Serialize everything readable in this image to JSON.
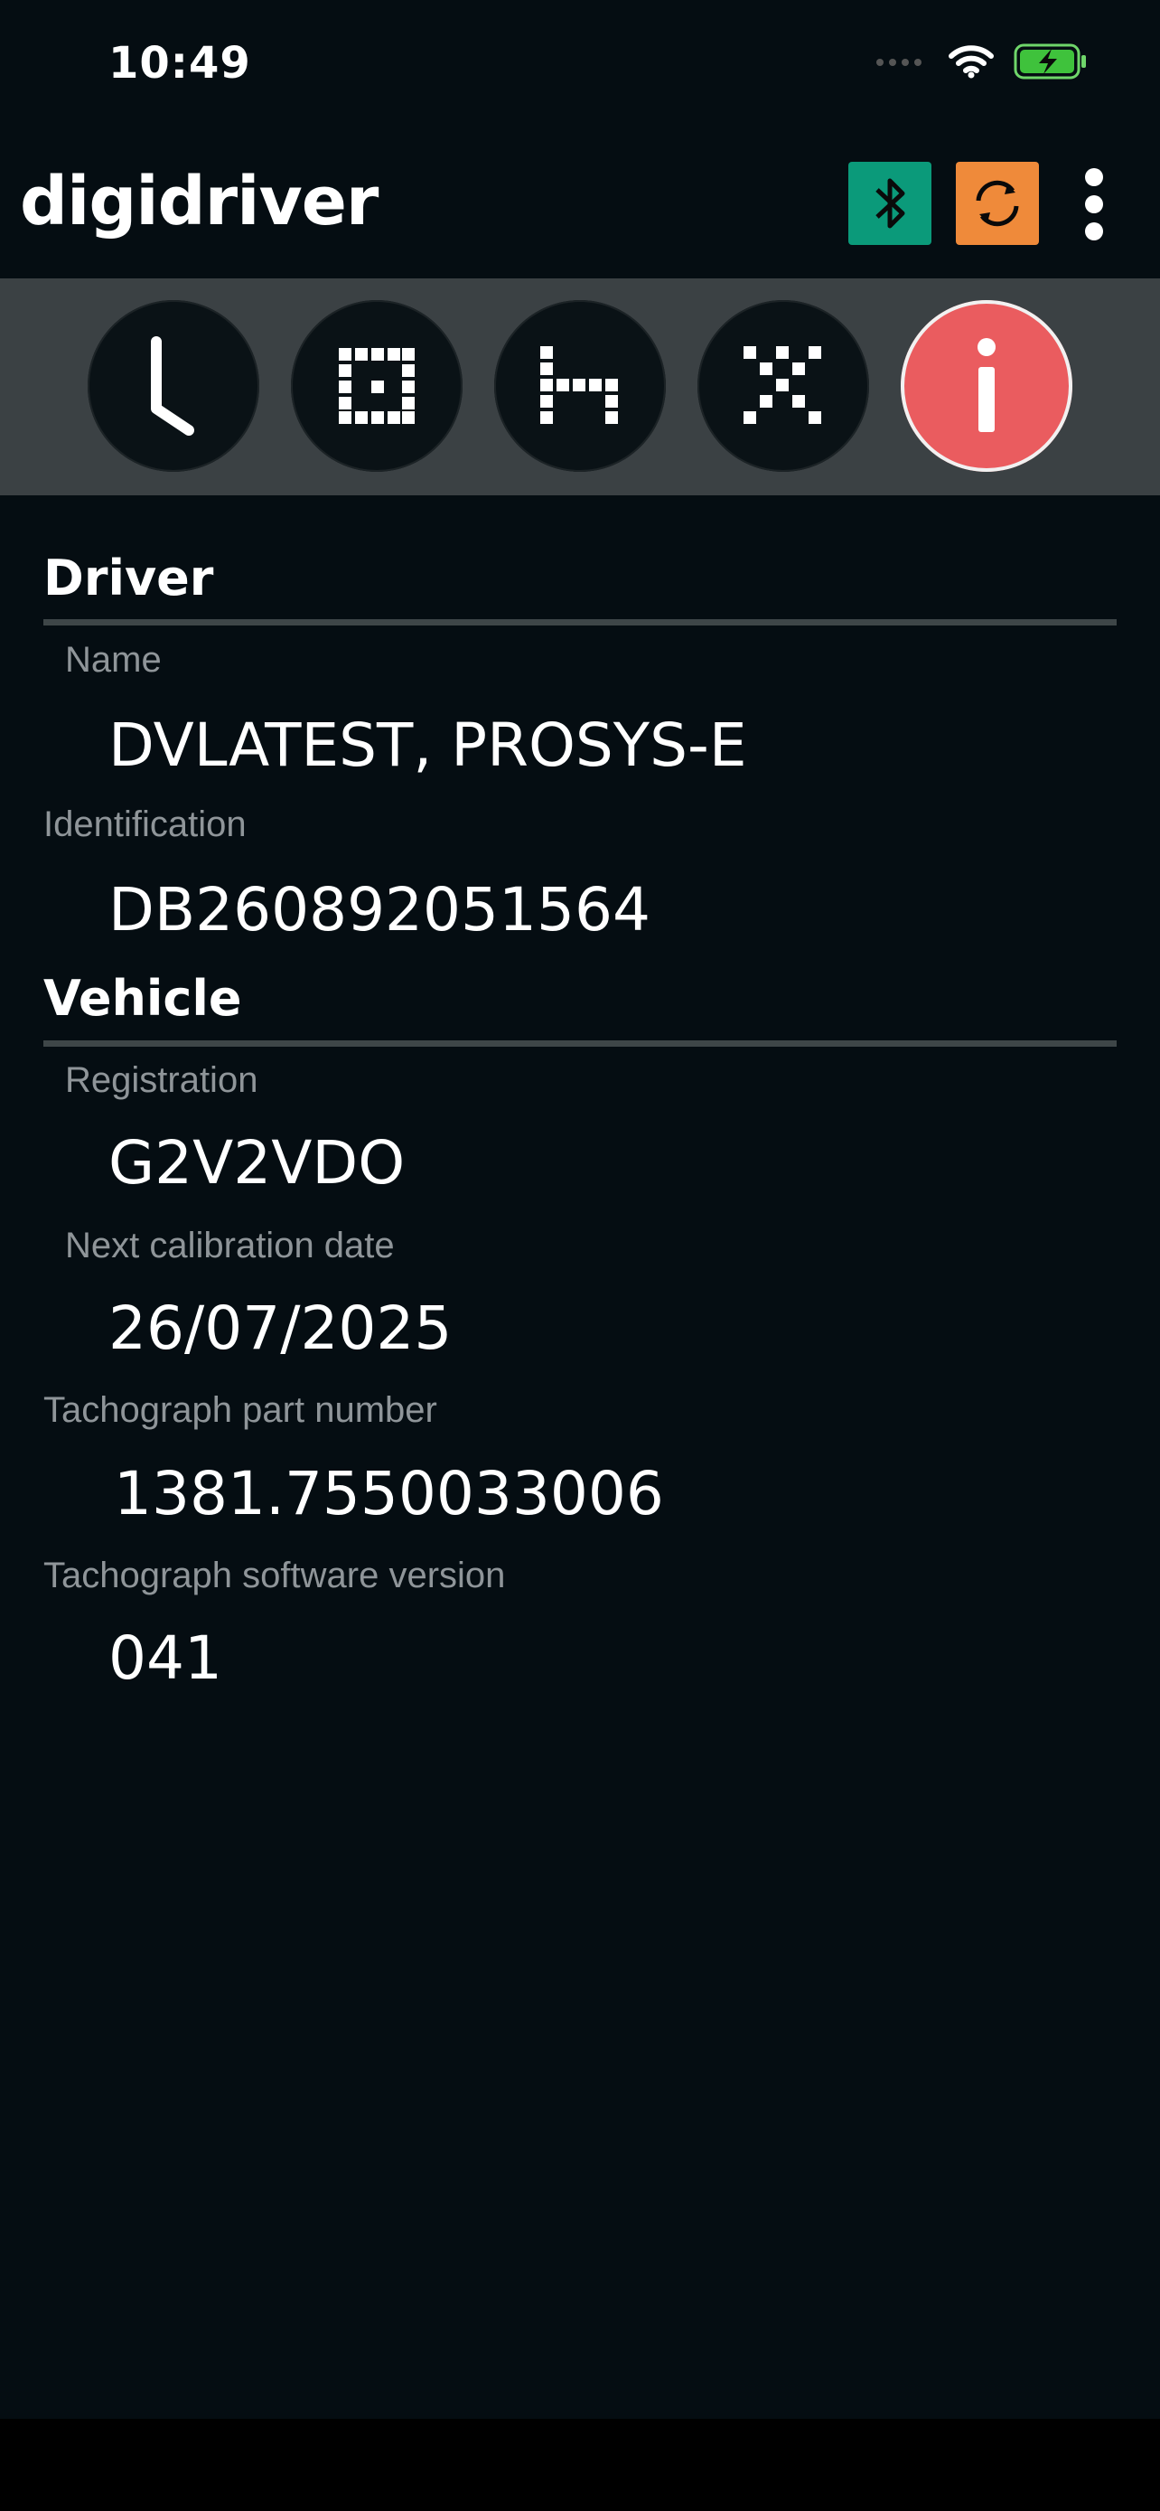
{
  "status_bar": {
    "time": "10:49",
    "icons": [
      "signal-dots-icon",
      "wifi-icon",
      "battery-charging-icon"
    ]
  },
  "header": {
    "logo": "digidriver",
    "buttons": [
      "bluetooth-icon",
      "sync-icon",
      "more-vertical-icon"
    ],
    "colors": {
      "bluetooth": "#0b9a7a",
      "sync": "#ef8a3a"
    }
  },
  "tabs": [
    {
      "icon": "clock-icon",
      "active": false
    },
    {
      "icon": "work-icon",
      "active": false
    },
    {
      "icon": "rest-bed-icon",
      "active": false
    },
    {
      "icon": "availability-icon",
      "active": false
    },
    {
      "icon": "info-icon",
      "active": true
    }
  ],
  "accent": "#ea5c5f",
  "driver": {
    "title": "Driver",
    "name_label": "Name",
    "name_value": "DVLATEST, PROSYS-E",
    "id_label": "Identification",
    "id_value": "DB260892051564"
  },
  "vehicle": {
    "title": "Vehicle",
    "reg_label": "Registration",
    "reg_value": "G2V2VDO",
    "cal_label": "Next calibration date",
    "cal_value": "26/07/2025",
    "part_label": "Tachograph part number",
    "part_value": "1381.7550033006",
    "sw_label": "Tachograph software version",
    "sw_value": "041"
  }
}
